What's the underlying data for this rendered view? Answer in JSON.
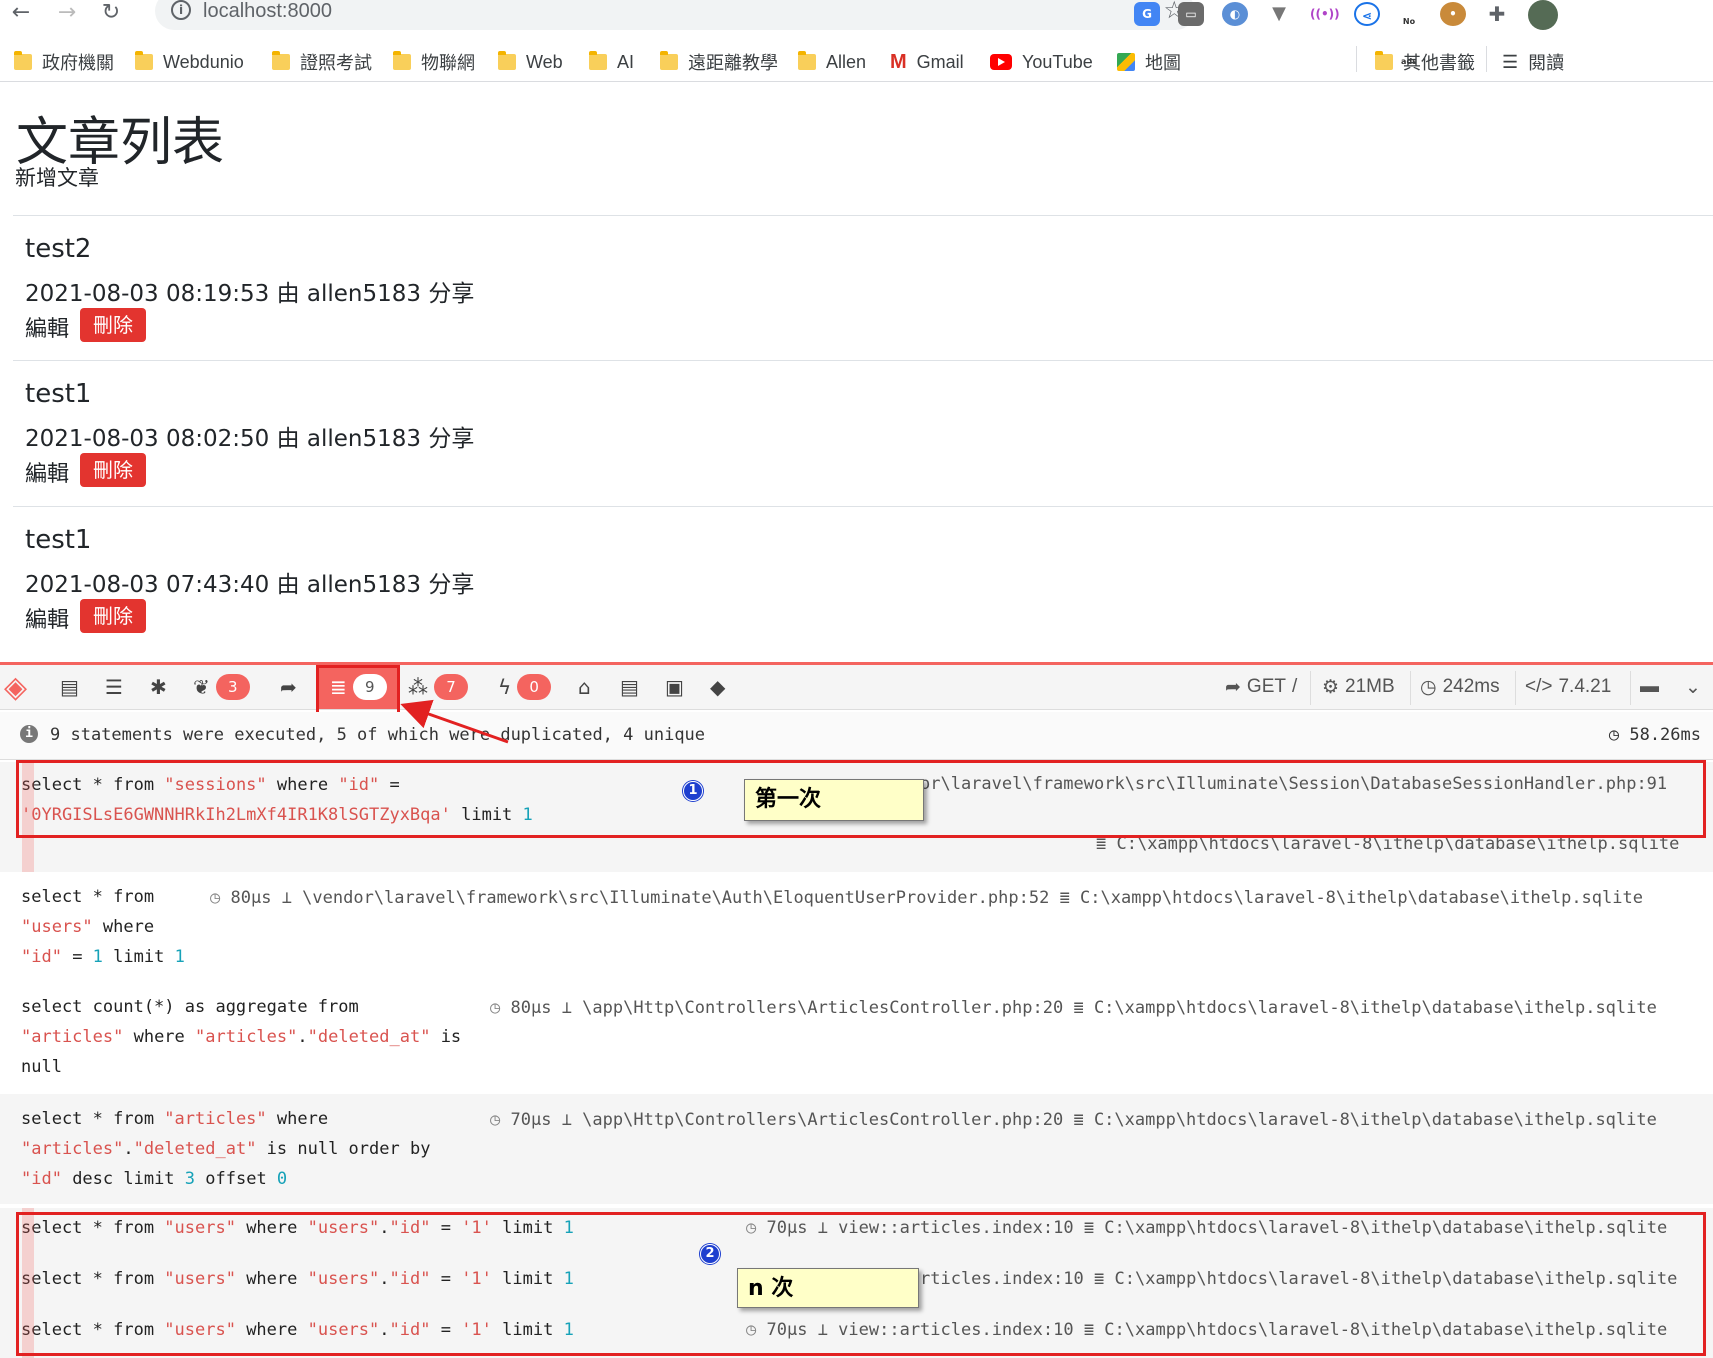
{
  "browser": {
    "url": "localhost:8000",
    "bookmarks": [
      "政府機關",
      "Webdunio",
      "證照考試",
      "物聯網",
      "Web",
      "AI",
      "遠距離教學",
      "Allen",
      "Gmail",
      "YouTube",
      "地圖",
      "其他書籤",
      "閱讀"
    ],
    "ext_noads": "No ads"
  },
  "page": {
    "title": "文章列表",
    "new_link": "新增文章",
    "articles": [
      {
        "title": "test2",
        "meta": "2021-08-03 08:19:53 由 allen5183 分享",
        "edit": "編輯",
        "delete": "刪除"
      },
      {
        "title": "test1",
        "meta": "2021-08-03 08:02:50 由 allen5183 分享",
        "edit": "編輯",
        "delete": "刪除"
      },
      {
        "title": "test1",
        "meta": "2021-08-03 07:43:40 由 allen5183 分享",
        "edit": "編輯",
        "delete": "刪除"
      }
    ]
  },
  "debugbar": {
    "badges": {
      "views": "3",
      "queries": "9",
      "models": "7",
      "events": "0"
    },
    "method": "GET",
    "route": "/",
    "memory": "21MB",
    "time": "242ms",
    "php": "7.4.21",
    "summary": "9 statements were executed, 5 of which were duplicated, 4 unique",
    "total_time": "58.26ms",
    "db_path": "C:\\xampp\\htdocs\\laravel-8\\ithelp\\database\\ithelp.sqlite",
    "statements": [
      {
        "time": "",
        "source": "or\\laravel\\framework\\src\\Illuminate\\Session\\DatabaseSessionHandler.php:91"
      },
      {
        "time": "80μs",
        "source": "\\vendor\\laravel\\framework\\src\\Illuminate\\Auth\\EloquentUserProvider.php:52"
      },
      {
        "time": "80μs",
        "source": "\\app\\Http\\Controllers\\ArticlesController.php:20"
      },
      {
        "time": "70μs",
        "source": "\\app\\Http\\Controllers\\ArticlesController.php:20"
      },
      {
        "time": "70μs",
        "source": "view::articles.index:10"
      },
      {
        "time": "",
        "source": "rticles.index:10"
      },
      {
        "time": "70μs",
        "source": "view::articles.index:10"
      }
    ]
  },
  "annotations": {
    "first": "第一次",
    "n_times": "n 次",
    "num1": "1",
    "num2": "2"
  },
  "colors": {
    "accent": "#f4645f",
    "danger": "#e3342f",
    "highlight": "#e22121",
    "callout_bg": "#ffffc8"
  }
}
